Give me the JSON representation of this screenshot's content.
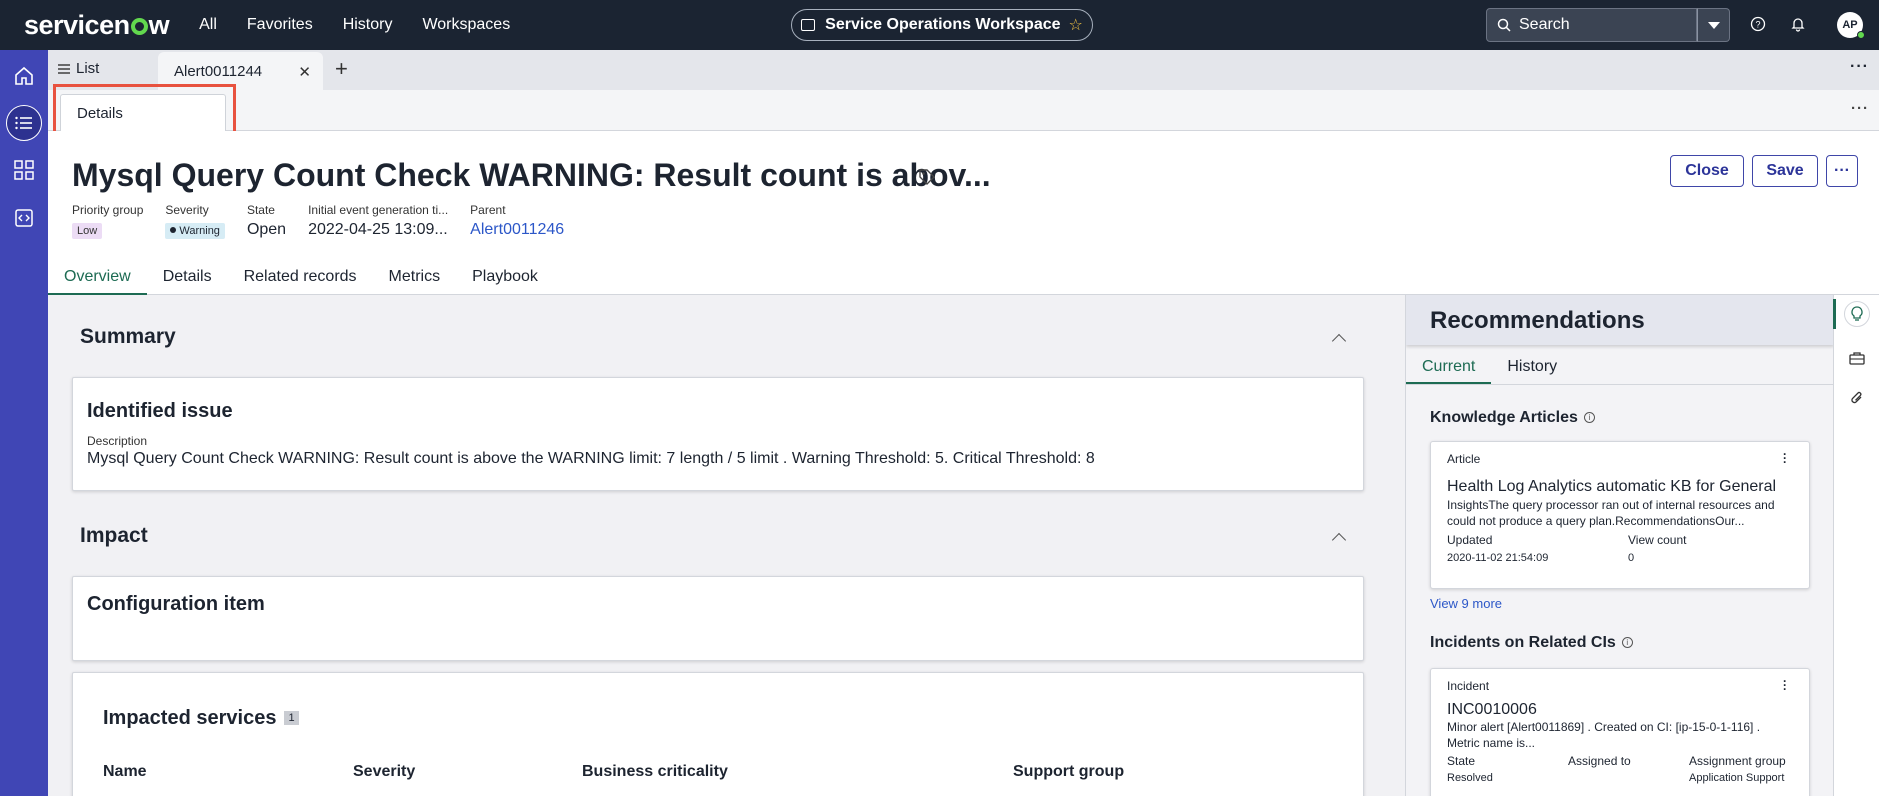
{
  "nav": {
    "brand": "servicenow",
    "links": [
      "All",
      "Favorites",
      "History",
      "Workspaces"
    ],
    "workspace": "Service Operations Workspace",
    "search_placeholder": "Search",
    "avatar_initials": "AP"
  },
  "tabs": {
    "list_label": "List",
    "active_label": "Alert0011244"
  },
  "subtab": {
    "label": "Details"
  },
  "record": {
    "title": "Mysql Query Count Check WARNING: Result count is abov...",
    "buttons": {
      "close": "Close",
      "save": "Save"
    },
    "fields": [
      {
        "label": "Priority group",
        "value": "Low"
      },
      {
        "label": "Severity",
        "value": "Warning"
      },
      {
        "label": "State",
        "value": "Open"
      },
      {
        "label": "Initial event generation ti...",
        "value": "2022-04-25 13:09..."
      },
      {
        "label": "Parent",
        "value": "Alert0011246"
      }
    ],
    "tabs": [
      "Overview",
      "Details",
      "Related records",
      "Metrics",
      "Playbook"
    ]
  },
  "overview": {
    "summary_title": "Summary",
    "identified_issue_title": "Identified issue",
    "description_label": "Description",
    "description_value": "Mysql Query Count Check WARNING: Result count is above the WARNING limit: 7 length / 5 limit . Warning Threshold: 5. Critical Threshold: 8",
    "impact_title": "Impact",
    "ci_title": "Configuration item",
    "impacted_services_title": "Impacted services",
    "impacted_services_count": "1",
    "columns": [
      "Name",
      "Severity",
      "Business criticality",
      "Support group"
    ]
  },
  "recommendations": {
    "title": "Recommendations",
    "tabs": [
      "Current",
      "History"
    ],
    "knowledge": {
      "title": "Knowledge Articles",
      "type": "Article",
      "article_title": "Health Log Analytics automatic KB for General",
      "body": "InsightsThe query processor ran out of internal resources and could not produce a query plan.RecommendationsOur...",
      "updated_label": "Updated",
      "updated_value": "2020-11-02 21:54:09",
      "view_count_label": "View count",
      "view_count_value": "0",
      "view_more": "View 9 more"
    },
    "incidents": {
      "title": "Incidents on Related CIs",
      "type": "Incident",
      "number": "INC0010006",
      "body": "Minor alert [Alert0011869] . Created on CI: [ip-15-0-1-116] . Metric name is...",
      "state_label": "State",
      "state_value": "Resolved",
      "assigned_to_label": "Assigned to",
      "assignment_group_label": "Assignment group",
      "assignment_group_value": "Application Support"
    }
  },
  "colors": {
    "nav_bg": "#1b2432",
    "rail_bg": "#4046b5",
    "accent_green": "#1d6b53",
    "button_blue": "#2c3499",
    "highlight_red": "#e8523f"
  }
}
